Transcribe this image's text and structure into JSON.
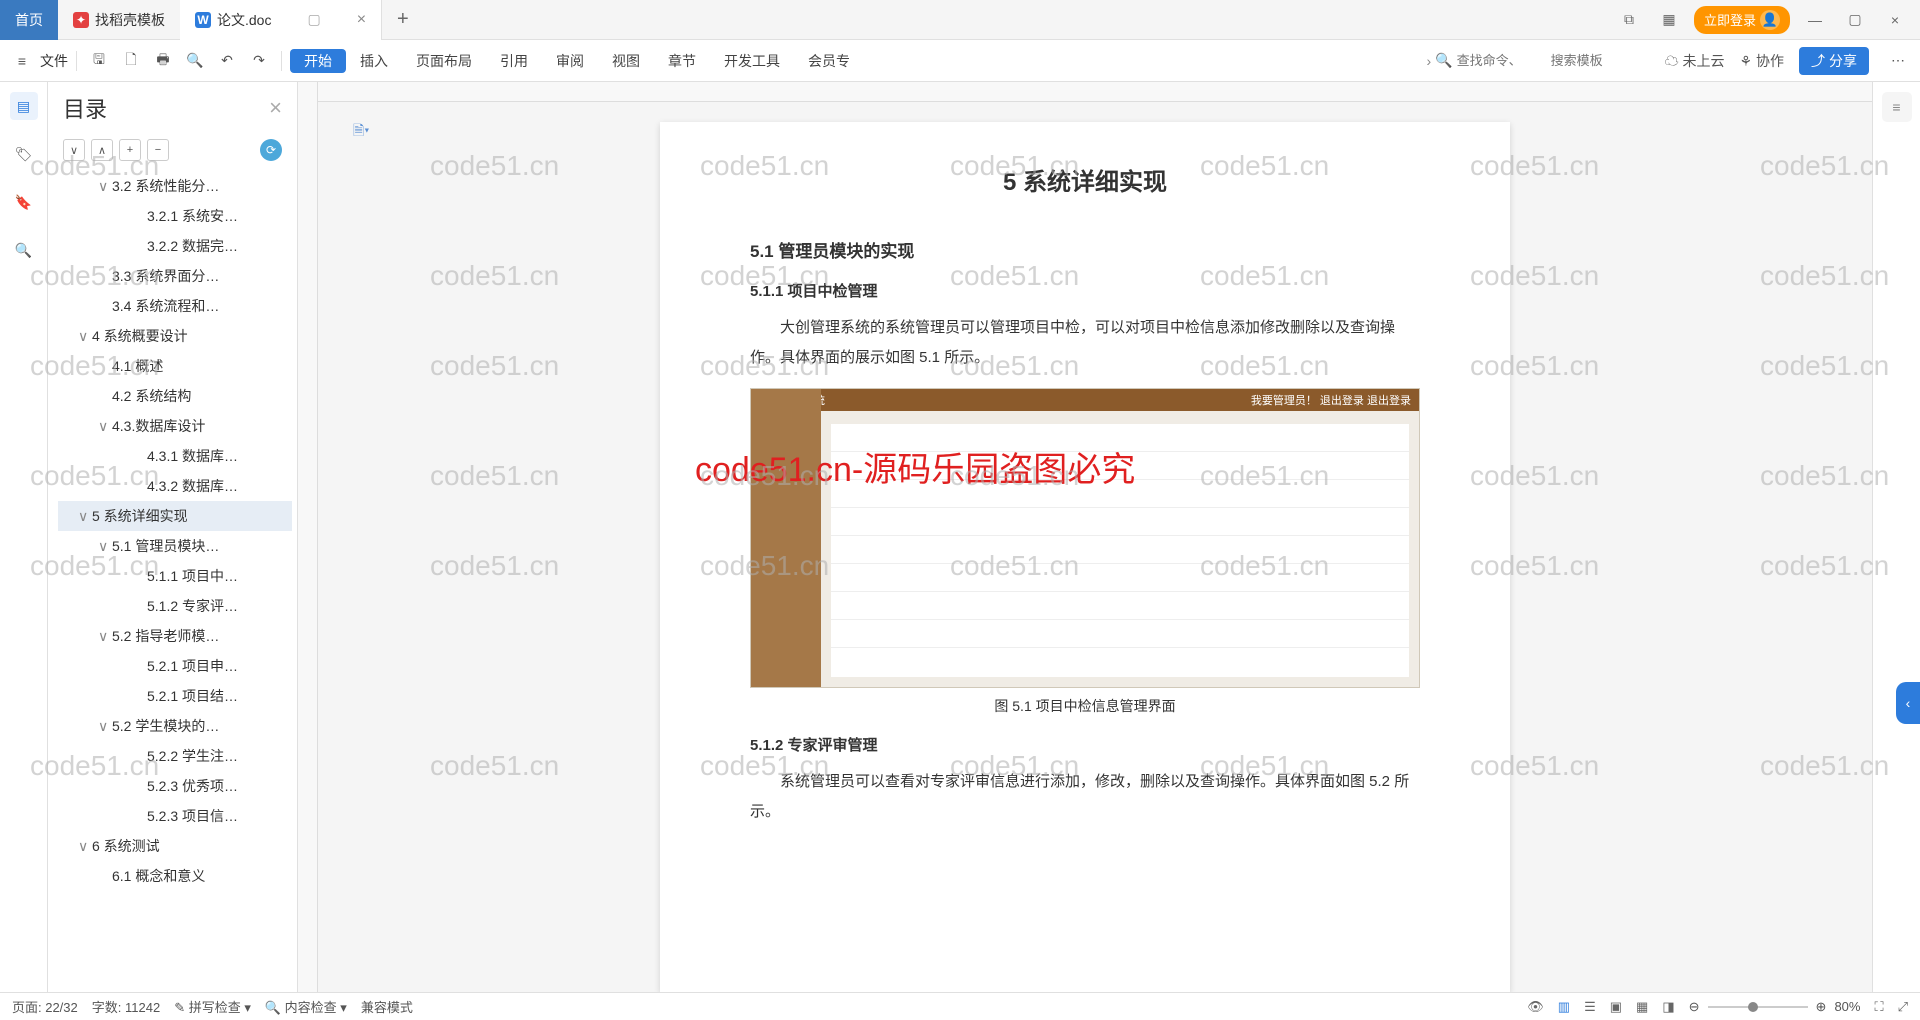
{
  "title_bar": {
    "home": "首页",
    "tab1": "找稻壳模板",
    "tab2": "论文.doc",
    "login": "立即登录"
  },
  "toolbar": {
    "file": "文件",
    "menus": [
      "开始",
      "插入",
      "页面布局",
      "引用",
      "审阅",
      "视图",
      "章节",
      "开发工具",
      "会员专"
    ],
    "search1": "查找命令、",
    "search2": "搜索模板",
    "cloud": "未上云",
    "coop": "协作",
    "share": "分享"
  },
  "outline": {
    "title": "目录",
    "items": [
      {
        "t": "3.2 系统性能分…",
        "ind": 2,
        "tog": "∨"
      },
      {
        "t": "3.2.1 系统安…",
        "ind": 4
      },
      {
        "t": "3.2.2 数据完…",
        "ind": 4
      },
      {
        "t": "3.3 系统界面分…",
        "ind": 2
      },
      {
        "t": "3.4 系统流程和…",
        "ind": 2
      },
      {
        "t": "4 系统概要设计",
        "ind": 1,
        "tog": "∨"
      },
      {
        "t": "4.1 概述",
        "ind": 2
      },
      {
        "t": "4.2 系统结构",
        "ind": 2
      },
      {
        "t": "4.3.数据库设计",
        "ind": 2,
        "tog": "∨"
      },
      {
        "t": "4.3.1 数据库…",
        "ind": 4
      },
      {
        "t": "4.3.2 数据库…",
        "ind": 4
      },
      {
        "t": "5 系统详细实现",
        "ind": 1,
        "tog": "∨",
        "sel": true
      },
      {
        "t": "5.1 管理员模块…",
        "ind": 2,
        "tog": "∨"
      },
      {
        "t": "5.1.1 项目中…",
        "ind": 4
      },
      {
        "t": "5.1.2 专家评…",
        "ind": 4
      },
      {
        "t": "5.2 指导老师模…",
        "ind": 2,
        "tog": "∨"
      },
      {
        "t": "5.2.1 项目申…",
        "ind": 4
      },
      {
        "t": "5.2.1 项目结…",
        "ind": 4
      },
      {
        "t": "5.2 学生模块的…",
        "ind": 2,
        "tog": "∨"
      },
      {
        "t": "5.2.2 学生注…",
        "ind": 4
      },
      {
        "t": "5.2.3 优秀项…",
        "ind": 4
      },
      {
        "t": "5.2.3 项目信…",
        "ind": 4
      },
      {
        "t": "6 系统测试",
        "ind": 1,
        "tog": "∨"
      },
      {
        "t": "6.1 概念和意义",
        "ind": 2
      }
    ]
  },
  "doc": {
    "chapter": "5 系统详细实现",
    "s1": "5.1  管理员模块的实现",
    "s11": "5.1.1  项目中检管理",
    "p1": "大创管理系统的系统管理员可以管理项目中检，可以对项目中检信息添加修改删除以及查询操作。具体界面的展示如图 5.1 所示。",
    "fig_sys": "大创管理系统",
    "fig_right": "我要管理员！  退出登录  退出登录",
    "cap1": "图 5.1  项目中检信息管理界面",
    "s12": "5.1.2  专家评审管理",
    "p2": "系统管理员可以查看对专家评审信息进行添加，修改，删除以及查询操作。具体界面如图 5.2 所示。",
    "watermark": "code51.cn-源码乐园盗图必究"
  },
  "status": {
    "page": "页面: 22/32",
    "words": "字数: 11242",
    "spell": "拼写检查",
    "content": "内容检查",
    "compat": "兼容模式",
    "zoom": "80%"
  },
  "bg_wm": "code51.cn"
}
